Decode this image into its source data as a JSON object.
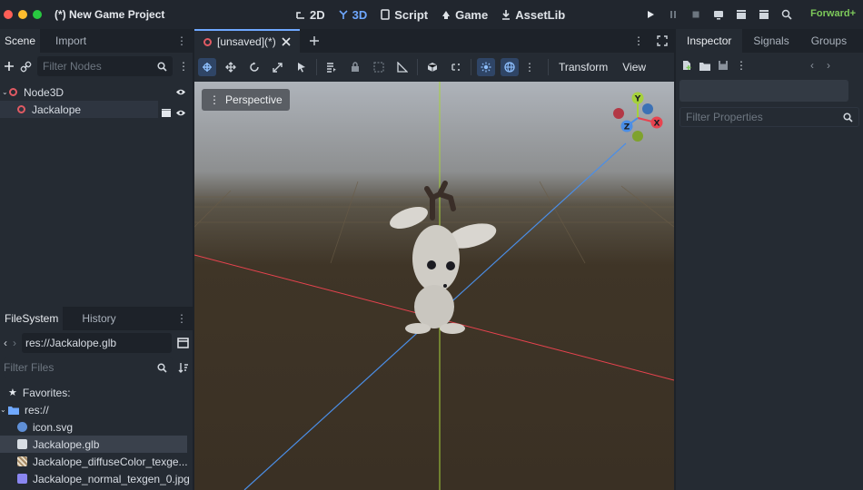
{
  "window": {
    "title": "(*) New Game Project",
    "traffic_colors": [
      "#ff5f57",
      "#febc2e",
      "#28c840"
    ]
  },
  "workspace_tabs": [
    {
      "label": "2D",
      "icon": "2d-icon",
      "active": false
    },
    {
      "label": "3D",
      "icon": "3d-icon",
      "active": true
    },
    {
      "label": "Script",
      "icon": "script-icon",
      "active": false
    },
    {
      "label": "Game",
      "icon": "game-icon",
      "active": false
    },
    {
      "label": "AssetLib",
      "icon": "assetlib-icon",
      "active": false
    }
  ],
  "renderer": "Forward+",
  "scene_dock": {
    "tabs": [
      "Scene",
      "Import"
    ],
    "filter_placeholder": "Filter Nodes",
    "nodes": [
      {
        "label": "Node3D",
        "icon": "node3d-icon"
      },
      {
        "label": "Jackalope",
        "icon": "node3d-icon"
      }
    ]
  },
  "filesystem_dock": {
    "tabs": [
      "FileSystem",
      "History"
    ],
    "path": "res://Jackalope.glb",
    "filter_placeholder": "Filter Files",
    "favorites_label": "Favorites:",
    "root_label": "res://",
    "files": [
      {
        "label": "icon.svg",
        "icon": "svg-file-icon"
      },
      {
        "label": "Jackalope.glb",
        "icon": "scene-file-icon"
      },
      {
        "label": "Jackalope_diffuseColor_texge...",
        "icon": "texture-icon"
      },
      {
        "label": "Jackalope_normal_texgen_0.jpg",
        "icon": "texture-icon"
      }
    ]
  },
  "scene_tab": {
    "label": "[unsaved](*)"
  },
  "viewport_menus": {
    "transform": "Transform",
    "view": "View"
  },
  "viewport": {
    "perspective_label": "Perspective"
  },
  "gizmo": {
    "x": "X",
    "y": "Y",
    "z": "Z"
  },
  "inspector_dock": {
    "tabs": [
      "Inspector",
      "Signals",
      "Groups"
    ],
    "filter_placeholder": "Filter Properties"
  },
  "colors": {
    "accent": "#6fa8ff",
    "node_icon": "#e05a63",
    "axis_x": "#e8434f",
    "axis_z": "#4b8ee6",
    "axis_y": "#a6d13c",
    "renderer_text": "#7dc95a"
  }
}
